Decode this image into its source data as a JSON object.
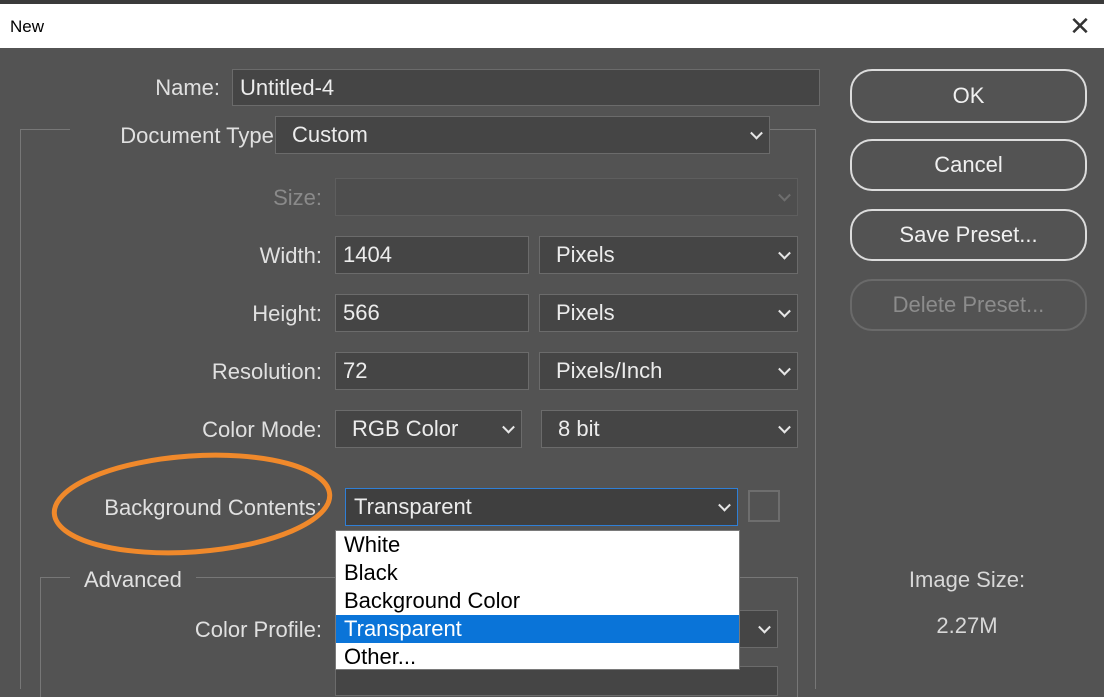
{
  "window": {
    "title": "New",
    "close_glyph": "✕"
  },
  "form": {
    "name_label": "Name:",
    "name_value": "Untitled-4",
    "doc_type_label": "Document Type:",
    "doc_type_value": "Custom",
    "size_label": "Size:",
    "size_value": "",
    "width_label": "Width:",
    "width_value": "1404",
    "width_unit": "Pixels",
    "height_label": "Height:",
    "height_value": "566",
    "height_unit": "Pixels",
    "resolution_label": "Resolution:",
    "resolution_value": "72",
    "resolution_unit": "Pixels/Inch",
    "color_mode_label": "Color Mode:",
    "color_mode_value": "RGB Color",
    "bit_depth_value": "8 bit",
    "background_label": "Background Contents:",
    "background_value": "Transparent",
    "advanced_label": "Advanced",
    "color_profile_label": "Color Profile:"
  },
  "dropdown": {
    "options": [
      "White",
      "Black",
      "Background Color",
      "Transparent",
      "Other..."
    ],
    "selected": "Transparent"
  },
  "buttons": {
    "ok": "OK",
    "cancel": "Cancel",
    "save_preset": "Save Preset...",
    "delete_preset": "Delete Preset..."
  },
  "image_size": {
    "label": "Image Size:",
    "value": "2.27M"
  },
  "colors": {
    "dialog_bg": "#535353",
    "field_bg": "#454545",
    "highlight": "#0a74d8",
    "annotation": "#f0892b"
  }
}
